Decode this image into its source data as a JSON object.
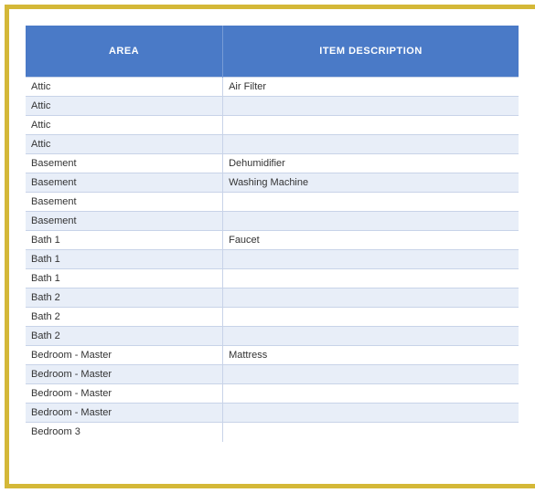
{
  "headers": {
    "area": "AREA",
    "description": "ITEM DESCRIPTION"
  },
  "rows": [
    {
      "area": "Attic",
      "description": "Air Filter"
    },
    {
      "area": "Attic",
      "description": ""
    },
    {
      "area": "Attic",
      "description": ""
    },
    {
      "area": "Attic",
      "description": ""
    },
    {
      "area": "Basement",
      "description": "Dehumidifier"
    },
    {
      "area": "Basement",
      "description": "Washing Machine"
    },
    {
      "area": "Basement",
      "description": ""
    },
    {
      "area": "Basement",
      "description": ""
    },
    {
      "area": "Bath 1",
      "description": "Faucet"
    },
    {
      "area": "Bath 1",
      "description": ""
    },
    {
      "area": "Bath 1",
      "description": ""
    },
    {
      "area": "Bath 2",
      "description": ""
    },
    {
      "area": "Bath 2",
      "description": ""
    },
    {
      "area": "Bath 2",
      "description": ""
    },
    {
      "area": "Bedroom - Master",
      "description": "Mattress"
    },
    {
      "area": "Bedroom - Master",
      "description": ""
    },
    {
      "area": "Bedroom - Master",
      "description": ""
    },
    {
      "area": "Bedroom - Master",
      "description": ""
    },
    {
      "area": "Bedroom 3",
      "description": ""
    }
  ]
}
